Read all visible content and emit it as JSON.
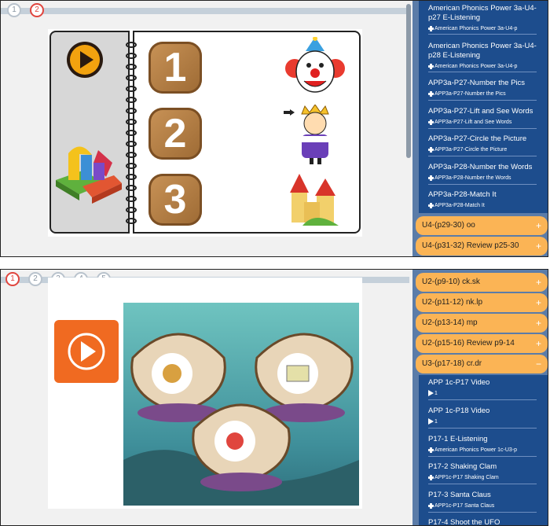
{
  "panel1": {
    "steps": [
      "1",
      "2"
    ],
    "active_step": "2",
    "numbers": [
      "1",
      "2",
      "3"
    ],
    "sidebar": {
      "items": [
        {
          "title": "American Phonics Power 3a-U4-p27 E-Listening",
          "sub": "American Phonics Power 3a-U4-p"
        },
        {
          "title": "American Phonics Power 3a-U4-p28 E-Listening",
          "sub": "American Phonics Power 3a-U4-p"
        },
        {
          "title": "APP3a-P27-Number the Pics",
          "sub": "APP3a-P27-Number the Pics"
        },
        {
          "title": "APP3a-P27-Lift and See Words",
          "sub": "APP3a-P27-Lift and See Words"
        },
        {
          "title": "APP3a-P27-Circle the Picture",
          "sub": "APP3a-P27-Circle the Picture"
        },
        {
          "title": "APP3a-P28-Number the Words",
          "sub": "APP3a-P28-Number the Words"
        },
        {
          "title": "APP3a-P28-Match It",
          "sub": "APP3a-P28-Match It"
        }
      ],
      "units": [
        "U4-(p29-30) oo",
        "U4-(p31-32) Review p25-30"
      ],
      "plus": "+"
    }
  },
  "panel2": {
    "steps": [
      "1",
      "2",
      "3",
      "4",
      "5"
    ],
    "active_step": "1",
    "sidebar": {
      "units": [
        "U2-(p9-10) ck.sk",
        "U2-(p11-12) nk.lp",
        "U2-(p13-14) mp",
        "U2-(p15-16) Review p9-14",
        "U3-(p17-18) cr.dr"
      ],
      "plus": "+",
      "minus": "−",
      "items": [
        {
          "title": "APP 1c-P17 Video",
          "sub": "1",
          "type": "video"
        },
        {
          "title": "APP 1c-P18 Video",
          "sub": "1",
          "type": "video"
        },
        {
          "title": "P17-1 E-Listening",
          "sub": "American Phonics Power 1c-U3-p",
          "type": "resource"
        },
        {
          "title": "P17-2 Shaking Clam",
          "sub": "APP1c-P17 Shaking Clam",
          "type": "resource"
        },
        {
          "title": "P17-3 Santa Claus",
          "sub": "APP1c-P17 Santa Claus",
          "type": "resource"
        },
        {
          "title": "P17-4 Shoot the UFO",
          "sub": "",
          "type": "resource"
        }
      ]
    }
  },
  "colors": {
    "orange": "#fbb455",
    "navy": "#1d4d8d",
    "sidebar": "#5b7ca8",
    "active": "#e0453e"
  }
}
